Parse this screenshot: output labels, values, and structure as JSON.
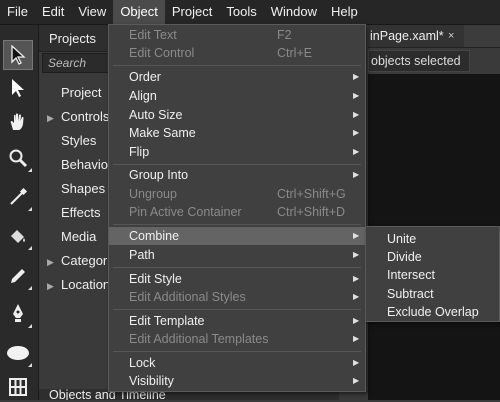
{
  "menubar": {
    "items": [
      "File",
      "Edit",
      "View",
      "Object",
      "Project",
      "Tools",
      "Window",
      "Help"
    ],
    "active": "Object"
  },
  "projects_panel": {
    "tab_label": "Projects",
    "search_placeholder": "Search",
    "items": [
      {
        "label": "Project",
        "expandable": false
      },
      {
        "label": "Controls",
        "expandable": true
      },
      {
        "label": "Styles",
        "expandable": false
      },
      {
        "label": "Behaviors",
        "expandable": false
      },
      {
        "label": "Shapes",
        "expandable": false
      },
      {
        "label": "Effects",
        "expandable": false
      },
      {
        "label": "Media",
        "expandable": false
      },
      {
        "label": "Categories",
        "expandable": true
      },
      {
        "label": "Locations",
        "expandable": true
      }
    ]
  },
  "bottom_panel": {
    "title": "Objects and Timeline"
  },
  "document": {
    "tab_label": "inPage.xaml*",
    "close_glyph": "×",
    "selection_status": "objects selected"
  },
  "object_menu": {
    "groups": [
      [
        {
          "label": "Edit Text",
          "shortcut": "F2",
          "enabled": false
        },
        {
          "label": "Edit Control",
          "shortcut": "Ctrl+E",
          "enabled": false
        }
      ],
      [
        {
          "label": "Order",
          "submenu": true
        },
        {
          "label": "Align",
          "submenu": true
        },
        {
          "label": "Auto Size",
          "submenu": true
        },
        {
          "label": "Make Same",
          "submenu": true
        },
        {
          "label": "Flip",
          "submenu": true
        }
      ],
      [
        {
          "label": "Group Into",
          "submenu": true
        },
        {
          "label": "Ungroup",
          "shortcut": "Ctrl+Shift+G",
          "enabled": false
        },
        {
          "label": "Pin Active Container",
          "shortcut": "Ctrl+Shift+D",
          "enabled": false
        }
      ],
      [
        {
          "label": "Combine",
          "submenu": true,
          "highlighted": true
        },
        {
          "label": "Path",
          "submenu": true
        }
      ],
      [
        {
          "label": "Edit Style",
          "submenu": true
        },
        {
          "label": "Edit Additional Styles",
          "submenu": true,
          "enabled": false
        }
      ],
      [
        {
          "label": "Edit Template",
          "submenu": true
        },
        {
          "label": "Edit Additional Templates",
          "submenu": true,
          "enabled": false
        }
      ],
      [
        {
          "label": "Lock",
          "submenu": true
        },
        {
          "label": "Visibility",
          "submenu": true
        }
      ]
    ]
  },
  "combine_submenu": {
    "items": [
      "Unite",
      "Divide",
      "Intersect",
      "Subtract",
      "Exclude Overlap"
    ]
  },
  "toolbar": {
    "tools": [
      {
        "name": "selection-tool-icon",
        "selected": true
      },
      {
        "name": "direct-selection-tool-icon"
      },
      {
        "name": "pan-tool-icon"
      },
      {
        "name": "zoom-tool-icon"
      },
      {
        "name": "eyedropper-tool-icon"
      },
      {
        "name": "paint-bucket-tool-icon"
      },
      {
        "name": "pencil-tool-icon"
      },
      {
        "name": "pen-tool-icon"
      },
      {
        "name": "ellipse-tool-icon"
      },
      {
        "name": "grid-tool-icon"
      }
    ]
  },
  "colors": {
    "menubar_bg": "#262626",
    "menu_bg": "#404040",
    "menu_highlight": "#646464",
    "disabled_text": "#8a8a8a",
    "artboard_bg": "#141414"
  }
}
